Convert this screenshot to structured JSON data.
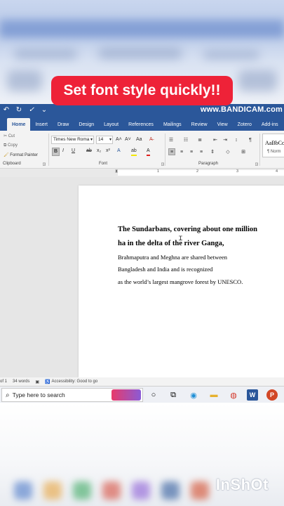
{
  "caption": "Set font style quickly!!",
  "watermark": "www.BANDICAM.com",
  "quick_access": {
    "undo": "↶",
    "redo": "↻",
    "customize": "⌄"
  },
  "tabs": [
    "Home",
    "Insert",
    "Draw",
    "Design",
    "Layout",
    "References",
    "Mailings",
    "Review",
    "View",
    "Zotero",
    "Add-ins"
  ],
  "clipboard": {
    "cut": "Cut",
    "copy": "Copy",
    "format_painter": "Format Painter",
    "label": "Clipboard"
  },
  "font": {
    "name": "Times New Roma",
    "size": "14",
    "label": "Font",
    "bold": "B",
    "italic": "I",
    "underline": "U",
    "strike": "ab",
    "sub": "x₂",
    "sup": "x²",
    "grow": "A˄",
    "shrink": "A˅",
    "case": "Aa"
  },
  "paragraph": {
    "label": "Paragraph",
    "pilcrow": "¶"
  },
  "styles": {
    "preview": "AaBbCc",
    "normal": "¶ Norm"
  },
  "ruler": [
    "1",
    "2",
    "3",
    "4"
  ],
  "document": {
    "lines": [
      {
        "text": "The Sundarbans, covering about one million",
        "bold": true
      },
      {
        "text": "ha in the delta of the river Ganga,",
        "bold": true
      },
      {
        "text": "Brahmaputra and Meghna are shared between",
        "bold": false
      },
      {
        "text": "Bangladesh and India and is recognized",
        "bold": false
      },
      {
        "text": "as the world’s largest mangrove forest by UNESCO.",
        "bold": false
      }
    ]
  },
  "status": {
    "page": "of 1",
    "words": "34 words",
    "accessibility": "Accessibility: Good to go"
  },
  "taskbar": {
    "search_placeholder": "Type here to search"
  },
  "inshot": "InShOt",
  "colors": {
    "word_blue": "#2b579a",
    "caption_red": "#ee2238"
  }
}
